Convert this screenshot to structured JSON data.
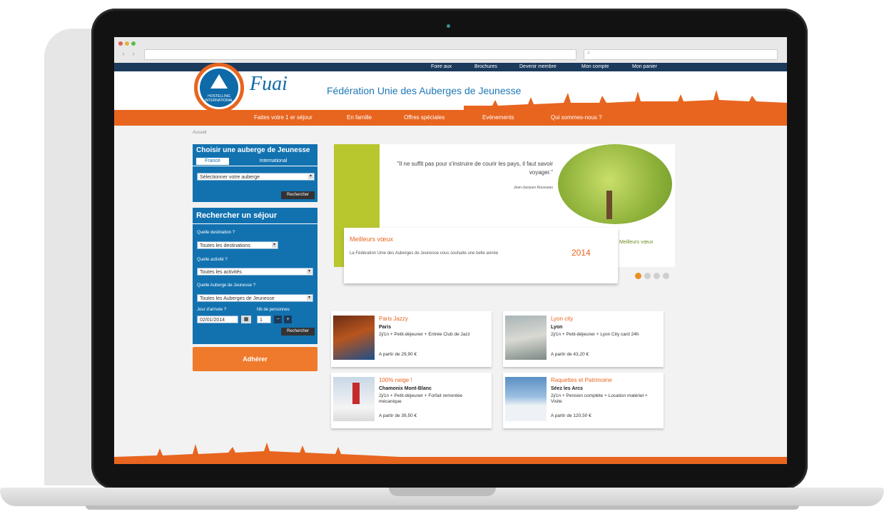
{
  "browser": {
    "url": "",
    "search_placeholder": ""
  },
  "topbar": {
    "links": [
      "Foire aux",
      "Brochures",
      "Devenir membre",
      "Mon compte",
      "Mon panier"
    ]
  },
  "header": {
    "logo_name": "Fuai",
    "logo_badge": "HOSTELLING INTERNATIONAL",
    "title": "Fédération Unie des Auberges de Jeunesse"
  },
  "nav": {
    "items": [
      "Faites votre 1 er séjour",
      "En famille",
      "Offres spéciales",
      "Evènements",
      "Qui sommes-nous ?"
    ]
  },
  "breadcrumb": "Accueil",
  "panel_choose": {
    "title": "Choisir une auberge de Jeunesse",
    "tab_france": "France",
    "tab_international": "International",
    "select_value": "Sélectionner votre auberge",
    "button": "Rechercher"
  },
  "panel_search": {
    "title": "Rechercher un séjour",
    "q_destination": "Quelle destination ?",
    "destination_value": "Toutes les destinations",
    "q_activity": "Quelle activité ?",
    "activity_value": "Toutes les activités",
    "q_hostel": "Quelle Auberge de Jeunesse ?",
    "hostel_value": "Toutes les Auberges de Jeunesse",
    "q_date": "Jour d'arrivée ?",
    "q_people": "Nb de personnes",
    "date_value": "02/01/2014",
    "people_value": "1",
    "button": "Rechercher"
  },
  "adherer_button": "Adhérer",
  "slider": {
    "quote": "\"Il ne suffit pas pour s'instruire de courir les pays, il faut savoir voyager.\"",
    "author": "Jean-Jacques Rousseau",
    "tree_label": "Meilleurs vœux",
    "voeux_title": "Meilleurs vœux",
    "voeux_text": "La Fédération Unie des Auberges de Jeunesse vous souhaite une belle année",
    "voeux_year": "2014"
  },
  "offers": [
    {
      "title": "Paris Jazzy",
      "city": "Paris",
      "desc": "2j/1n + Petit-déjeuner + Entrée Club de Jazz",
      "price": "A partir de 29,90 €"
    },
    {
      "title": "Lyon city",
      "city": "Lyon",
      "desc": "2j/1n + Petit-déjeuner + Lyon City card 24h",
      "price": "A partir de 43,20 €"
    },
    {
      "title": "100% neige !",
      "city": "Chamonix Mont-Blanc",
      "desc": "2j/1n + Petit-déjeuner + Forfait remontée mécanique",
      "price": "A partir de 39,50 €"
    },
    {
      "title": "Raquettes et Patrimoine",
      "city": "Séez les Arcs",
      "desc": "2j/1n + Pension complète + Location matériel + Visite",
      "price": "A partir de 120,50 €"
    }
  ],
  "colors": {
    "brand_orange": "#e8651f",
    "brand_blue": "#1272b0",
    "dark_navy": "#1b3a5c",
    "green": "#b8c72e"
  }
}
